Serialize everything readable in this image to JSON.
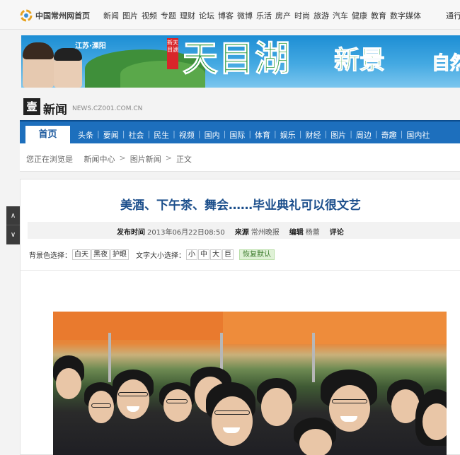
{
  "topbar": {
    "site_home": "中国常州网首页",
    "nav": [
      "新闻",
      "图片",
      "视频",
      "专题",
      "理财",
      "论坛",
      "博客",
      "微博",
      "乐活",
      "房产",
      "时尚",
      "旅游",
      "汽车",
      "健康",
      "教育",
      "数字媒体"
    ],
    "more": "通行"
  },
  "banner": {
    "location": "江苏·溧阳",
    "stamp": "新天目湖",
    "title_main": "天目湖",
    "title_sub": "新景",
    "title_tail": "自然"
  },
  "channel": {
    "badge": "壹",
    "title": "新闻",
    "domain": "NEWS.CZ001.COM.CN"
  },
  "mainnav": {
    "home": "首页",
    "items": [
      "头条",
      "要闻",
      "社会",
      "民生",
      "视频",
      "国内",
      "国际",
      "体育",
      "娱乐",
      "财经",
      "图片",
      "周边",
      "奇趣",
      "国内社"
    ]
  },
  "breadcrumb": {
    "prefix": "您正在浏览是",
    "items": [
      "新闻中心",
      "图片新闻",
      "正文"
    ]
  },
  "sidewidget": {
    "up": "∧",
    "down": "∨"
  },
  "article": {
    "headline": "美酒、下午茶、舞会……毕业典礼可以很文艺",
    "meta": {
      "time_label": "发布时间",
      "time_value": "2013年06月22日08:50",
      "source_label": "来源",
      "source_value": "常州晚报",
      "editor_label": "编辑",
      "editor_value": "杨蕾",
      "comment_label": "评论"
    },
    "tools": {
      "bg_label": "背景色选择：",
      "bg_options": [
        "白天",
        "黑夜",
        "护眼"
      ],
      "size_label": "文字大小选择：",
      "size_options": [
        "小",
        "中",
        "大",
        "巨"
      ],
      "restore": "恢复默认"
    }
  },
  "colors": {
    "nav_blue": "#1d6fbd",
    "headline_blue": "#1c4f8c",
    "restore_green": "#dff1d6"
  }
}
